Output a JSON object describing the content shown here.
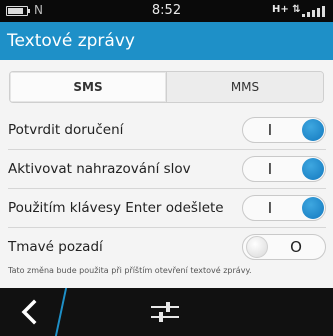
{
  "status_bar": {
    "time": "8:52",
    "notification": "N",
    "network": "H+ ⇅",
    "battery_icon": "battery-icon",
    "signal_icon": "signal-icon"
  },
  "title_bar": {
    "title": "Textové zprávy",
    "color": "#1e90c8"
  },
  "tabs": [
    {
      "label": "SMS",
      "active": true
    },
    {
      "label": "MMS",
      "active": false
    }
  ],
  "settings": [
    {
      "label": "Potvrdit doručení",
      "on": true,
      "mark": "I"
    },
    {
      "label": "Aktivovat nahrazování slov",
      "on": true,
      "mark": "I"
    },
    {
      "label": "Použitím klávesy Enter odešlete",
      "on": true,
      "mark": "I"
    },
    {
      "label": "Tmavé pozadí",
      "on": false,
      "mark": "O"
    }
  ],
  "footnote": "Tato změna bude použita při příštím otevření textové zprávy.",
  "bottom_bar": {
    "back_icon": "back-chevron-icon",
    "menu_icon": "sliders-icon"
  }
}
